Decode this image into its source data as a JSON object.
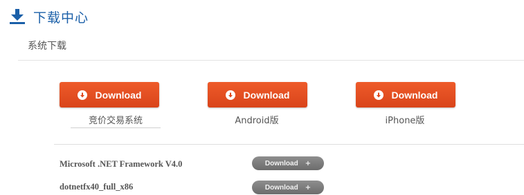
{
  "header": {
    "title": "下载中心",
    "accent_color": "#1a5fa8",
    "icon": "download-icon"
  },
  "section": {
    "subtitle": "系统下载"
  },
  "primary_downloads": [
    {
      "button_label": "Download",
      "caption": "竞价交易系统",
      "icon": "download-circle-icon"
    },
    {
      "button_label": "Download",
      "caption": "Android版",
      "icon": "download-circle-icon"
    },
    {
      "button_label": "Download",
      "caption": "iPhone版",
      "icon": "download-circle-icon"
    }
  ],
  "button_color": "#e8522a",
  "files": [
    {
      "name": "Microsoft .NET Framework V4.0",
      "button_label": "Download",
      "button_icon": "plus-icon"
    },
    {
      "name": "dotnetfx40_full_x86",
      "button_label": "Download",
      "button_icon": "plus-icon"
    }
  ],
  "small_button_color": "#7a7a7a"
}
